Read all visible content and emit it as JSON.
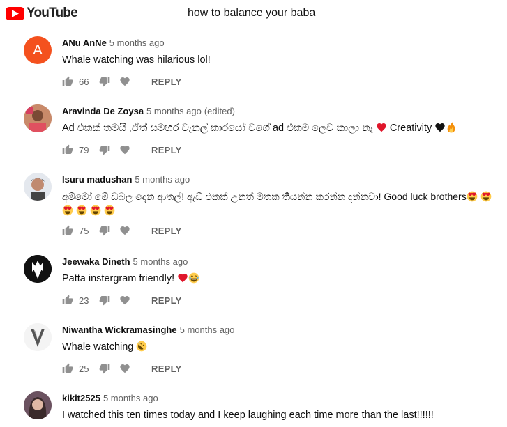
{
  "header": {
    "logo_text": "YouTube",
    "search_value": "how to balance your baba"
  },
  "colors": {
    "brand_red": "#ff0000",
    "avatar_anu": "#f4511e"
  },
  "comments": [
    {
      "author": "ANu AnNe",
      "time": "5 months ago",
      "edited": "",
      "avatar_letter": "A",
      "text": "Whale watching was hilarious lol!",
      "likes": "66",
      "reply": "REPLY"
    },
    {
      "author": "Aravinda De Zoysa",
      "time": "5 months ago",
      "edited": "(edited)",
      "text": "Ad එකක් තමයි ,ඒත් සමහර චැනල් කාරයෝ වගේ ad එකම ලෙව කාලා නෑ",
      "text_after": "Creativity",
      "likes": "79",
      "reply": "REPLY"
    },
    {
      "author": "Isuru madushan",
      "time": "5 months ago",
      "edited": "",
      "text": "අම්මෝ මේ ඩබල දෙන ආතල්! ඇඩ් එකක් උනත් මතක තියන්න කරන්න දන්නවා! Good luck brothers",
      "likes": "75",
      "reply": "REPLY"
    },
    {
      "author": "Jeewaka Dineth",
      "time": "5 months ago",
      "edited": "",
      "text": "Patta instergram friendly!",
      "likes": "23",
      "reply": "REPLY"
    },
    {
      "author": "Niwantha Wickramasinghe",
      "time": "5 months ago",
      "edited": "",
      "text": "Whale watching",
      "likes": "25",
      "reply": "REPLY"
    },
    {
      "author": "kikit2525",
      "time": "5 months ago",
      "edited": "",
      "text": "I watched this ten times today and I keep laughing each time more than the last!!!!!!"
    }
  ],
  "icons": [
    "youtube-play-icon",
    "thumbs-up-icon",
    "thumbs-down-icon",
    "heart-icon",
    "red-heart-emoji",
    "black-heart-emoji",
    "fire-emoji",
    "heart-eyes-emoji",
    "tears-of-joy-emoji",
    "rofl-emoji"
  ]
}
